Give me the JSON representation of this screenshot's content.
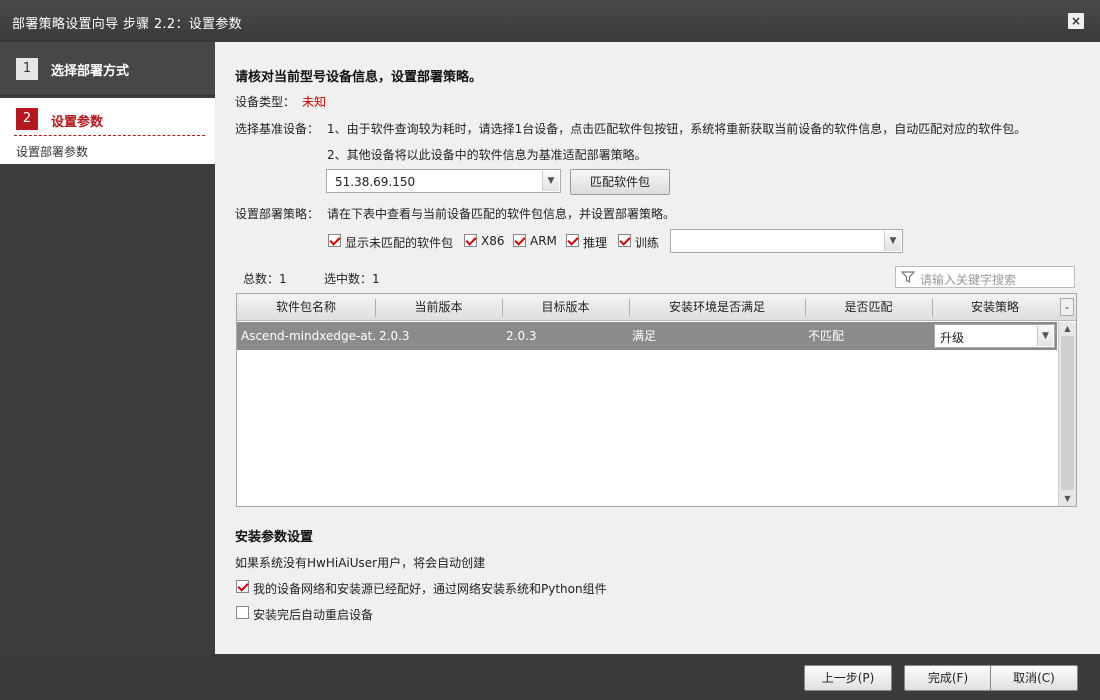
{
  "window": {
    "title": "部署策略设置向导 步骤 2.2：设置参数",
    "close_label": "×"
  },
  "sidebar": {
    "steps": [
      {
        "num": "1",
        "label": "选择部署方式"
      },
      {
        "num": "2",
        "label": "设置参数",
        "sub": "设置部署参数"
      }
    ]
  },
  "main": {
    "heading": "请核对当前型号设备信息，设置部署策略。",
    "device_type_label": "设备类型：",
    "device_type_value": "未知",
    "base_device_label": "选择基准设备：",
    "base_device_note1": "1、由于软件查询较为耗时，请选择1台设备，点击匹配软件包按钮，系统将重新获取当前设备的软件信息，自动匹配对应的软件包。",
    "base_device_note2": "2、其他设备将以此设备中的软件信息为基准适配部署策略。",
    "device_select_value": "51.38.69.150",
    "match_button": "匹配软件包",
    "policy_label": "设置部署策略：",
    "policy_note": "请在下表中查看与当前设备匹配的软件包信息，并设置部署策略。",
    "filters": [
      {
        "label": "显示未匹配的软件包",
        "checked": true
      },
      {
        "label": "X86",
        "checked": true
      },
      {
        "label": "ARM",
        "checked": true
      },
      {
        "label": "推理",
        "checked": true
      },
      {
        "label": "训练",
        "checked": true
      }
    ],
    "filter_select_value": "",
    "total_label": "总数：1",
    "selected_label": "选中数：1",
    "search_placeholder": "请输入关键字搜索",
    "table": {
      "columns": [
        "软件包名称",
        "当前版本",
        "目标版本",
        "安装环境是否满足",
        "是否匹配",
        "安装策略"
      ],
      "rows": [
        [
          "Ascend-mindxedge-at...",
          "2.0.3",
          "2.0.3",
          "满足",
          "不匹配",
          "升级"
        ]
      ]
    },
    "install_section_title": "安装参数设置",
    "install_note": "如果系统没有HwHiAiUser用户，将会自动创建",
    "install_options": [
      {
        "label": "我的设备网络和安装源已经配好，通过网络安装系统和Python组件",
        "checked": true
      },
      {
        "label": "安装完后自动重启设备",
        "checked": false
      }
    ]
  },
  "footer": {
    "prev": "上一步(P)",
    "finish": "完成(F)",
    "cancel": "取消(C)"
  },
  "colors": {
    "accent": "#b5191f",
    "selected_row": "#8b8b8b"
  }
}
